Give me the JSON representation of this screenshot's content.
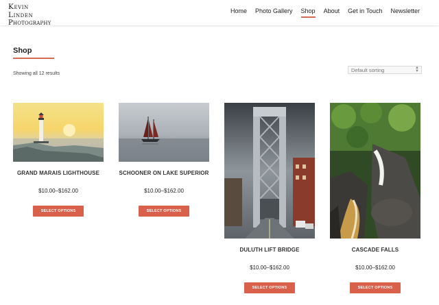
{
  "header": {
    "logo_line1": "Kevin Linden",
    "logo_line2": "Photography",
    "nav": [
      {
        "label": "Home",
        "active": false
      },
      {
        "label": "Photo Gallery",
        "active": false
      },
      {
        "label": "Shop",
        "active": true
      },
      {
        "label": "About",
        "active": false
      },
      {
        "label": "Get in Touch",
        "active": false
      },
      {
        "label": "Newsletter",
        "active": false
      }
    ]
  },
  "page": {
    "title": "Shop",
    "result_count": "Showing all 12 results",
    "sort_selected": "Default sorting"
  },
  "products": [
    {
      "name": "GRAND MARAIS LIGHTHOUSE",
      "price": "$10.00–$162.00",
      "button": "SELECT OPTIONS"
    },
    {
      "name": "SCHOONER ON LAKE SUPERIOR",
      "price": "$10.00–$162.00",
      "button": "SELECT OPTIONS"
    },
    {
      "name": "DULUTH LIFT BRIDGE",
      "price": "$10.00–$162.00",
      "button": "SELECT OPTIONS"
    },
    {
      "name": "CASCADE FALLS",
      "price": "$10.00–$162.00",
      "button": "SELECT OPTIONS"
    }
  ],
  "colors": {
    "accent": "#d66a52",
    "button": "#d9614c"
  }
}
